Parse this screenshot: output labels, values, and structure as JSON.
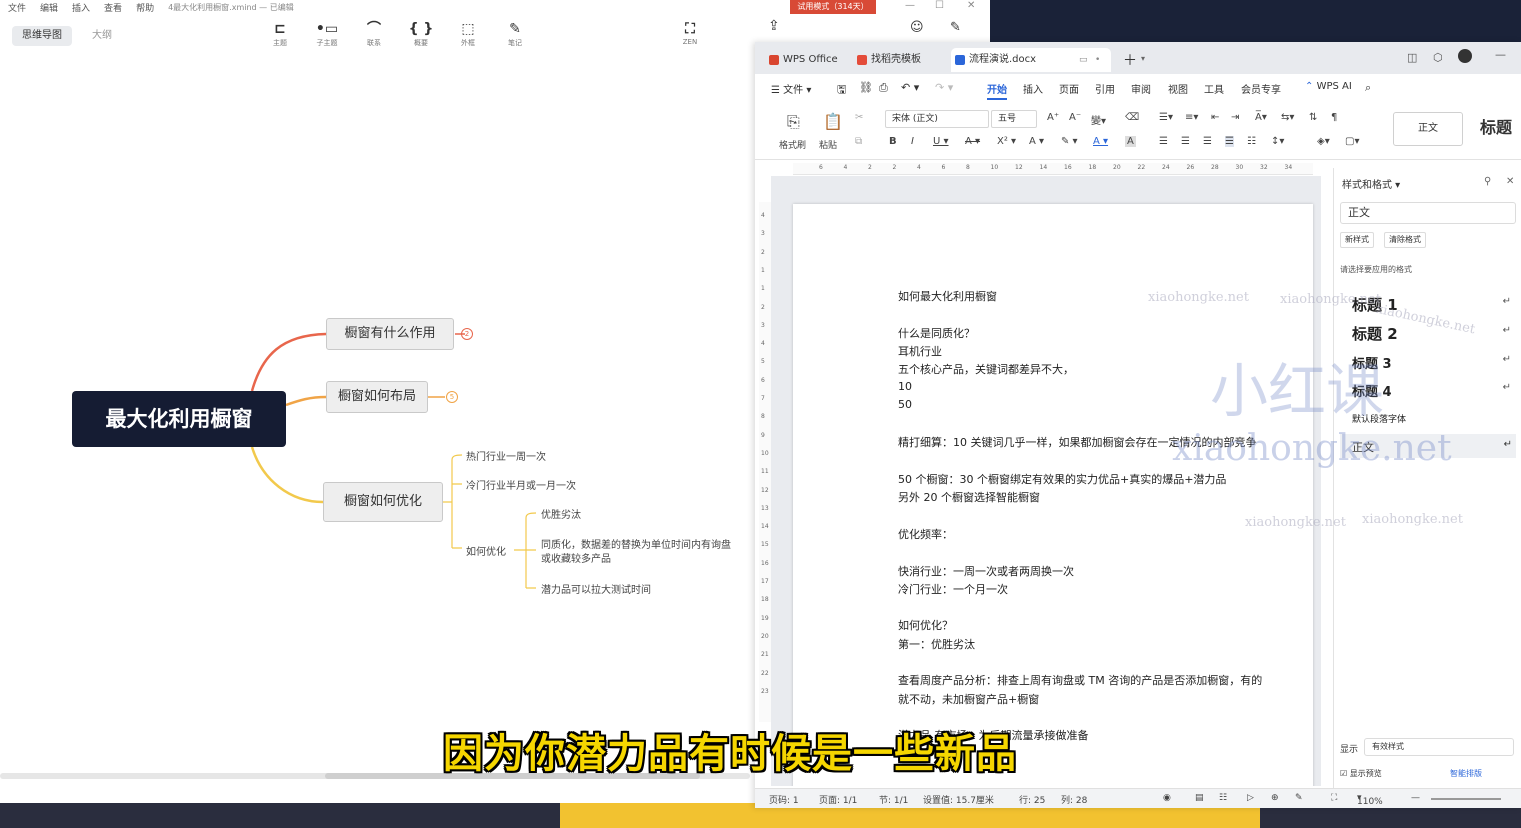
{
  "xmind": {
    "menu": [
      "文件",
      "编辑",
      "插入",
      "查看",
      "帮助"
    ],
    "file_title": "4最大化利用橱窗.xmind — 已编辑",
    "modes": [
      "思维导图",
      "大纲"
    ],
    "tools": [
      {
        "icon": "topic-icon",
        "label": "主题",
        "glyph": "⊏"
      },
      {
        "icon": "subtopic-icon",
        "label": "子主题",
        "glyph": "•▭"
      },
      {
        "icon": "relation-icon",
        "label": "联系",
        "glyph": "⌒"
      },
      {
        "icon": "summary-icon",
        "label": "概要",
        "glyph": "{ }"
      },
      {
        "icon": "boundary-icon",
        "label": "外框",
        "glyph": "⬚"
      },
      {
        "icon": "note-icon",
        "label": "笔记",
        "glyph": "✎"
      },
      {
        "icon": "zen-icon",
        "label": "ZEN",
        "glyph": "⛶"
      }
    ],
    "central_topic": "最大化利用橱窗",
    "topics": [
      {
        "label": "橱窗有什么作用",
        "badge": "2"
      },
      {
        "label": "橱窗如何布局",
        "badge": "5"
      },
      {
        "label": "橱窗如何优化"
      }
    ],
    "subtopics": {
      "hot": "热门行业一周一次",
      "cold": "冷门行业半月或一月一次",
      "how": "如何优化",
      "leaf1": "优胜劣汰",
      "leaf2_line1": "同质化，数据差的替换为单位时间内有询盘",
      "leaf2_line2": "或收藏较多产品",
      "leaf3": "潜力品可以拉大测试时间"
    }
  },
  "trial_badge": "试用模式（314天）",
  "wps": {
    "tabs": [
      "WPS Office",
      "找稻壳模板",
      "流程演说.docx"
    ],
    "menu": [
      "文件",
      "开始",
      "插入",
      "页面",
      "引用",
      "审阅",
      "视图",
      "工具",
      "会员专享",
      "WPS AI"
    ],
    "active_menu": "开始",
    "ribbon": {
      "format_painter": "格式刷",
      "paste": "粘贴",
      "font": "宋体 (正文)",
      "size": "五号",
      "style_normal": "正文",
      "style_heading": "标题"
    },
    "ruler": [
      "6",
      "4",
      "2",
      "2",
      "4",
      "6",
      "8",
      "10",
      "12",
      "14",
      "16",
      "18",
      "20",
      "22",
      "24",
      "26",
      "28",
      "30",
      "32",
      "34"
    ],
    "vruler": [
      "4",
      "3",
      "2",
      "1",
      "1",
      "2",
      "3",
      "4",
      "5",
      "6",
      "7",
      "8",
      "9",
      "10",
      "11",
      "12",
      "13",
      "14",
      "15",
      "16",
      "17",
      "18",
      "19",
      "20",
      "21",
      "22",
      "23"
    ],
    "doc_lines": [
      "如何最大化利用橱窗",
      "什么是同质化？",
      "耳机行业",
      "五个核心产品，关键词都差异不大，",
      "10",
      "50",
      "精打细算：10 关键词几乎一样，如果都加橱窗会存在一定情况的内部竞争",
      "50 个橱窗：30 个橱窗绑定有效果的实力优品+真实的爆品+潜力品",
      "另外 20 个橱窗选择智能橱窗",
      "优化频率：",
      "快消行业：一周一次或者两周换一次",
      "冷门行业：一个月一次",
      "如何优化？",
      "第一：优胜劣汰",
      "查看周度产品分析：排查上周有询盘或 TM 咨询的产品是否添加橱窗，有的",
      "就不动，未加橱窗产品+橱窗",
      "潜力品        有市场，为后期流量承接做准备"
    ],
    "side_panel": {
      "title": "样式和格式",
      "current": "正文",
      "new_style": "新样式",
      "clear": "清除格式",
      "prompt": "请选择要应用的格式",
      "styles": [
        "标题  1",
        "标题  2",
        "标题  3",
        "标题  4",
        "默认段落字体",
        "正文"
      ],
      "show_label": "显示",
      "show_value": "有效样式",
      "preview": "显示预览",
      "smart": "智能排版"
    },
    "status": {
      "page": "页码: 1",
      "pages": "页面: 1/1",
      "section": "节: 1/1",
      "setting": "设置值: 15.7厘米",
      "row": "行: 25",
      "col": "列: 28",
      "zoom": "110%"
    }
  },
  "watermarks": [
    "xiaohongke.net",
    "小红课"
  ],
  "subtitle": "因为你潜力品有时候是一些新品",
  "colors": {
    "central_bg": "#151c33",
    "branch_1": "#e8664c",
    "branch_2": "#f0a447",
    "branch_3": "#f2c94c",
    "subtitle": "#f5d600",
    "wps_blue": "#2b66d9"
  }
}
